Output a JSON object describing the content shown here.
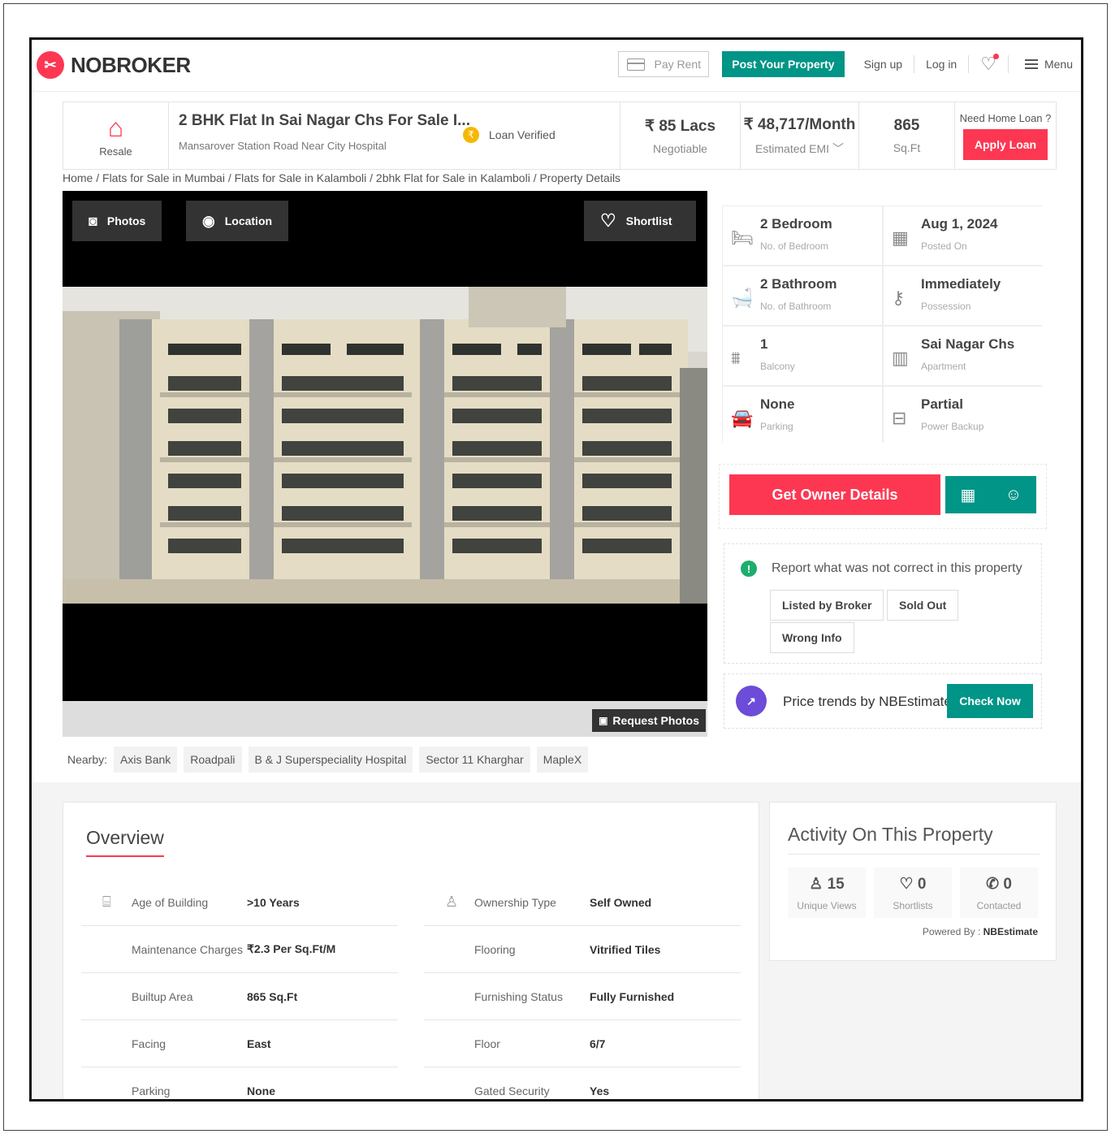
{
  "header": {
    "brand": "NOBROKER",
    "pay_rent": "Pay Rent",
    "post_property": "Post Your Property",
    "sign_up": "Sign up",
    "log_in": "Log in",
    "menu": "Menu"
  },
  "summary": {
    "type_label": "Resale",
    "title": "2 BHK Flat In Sai Nagar Chs For Sale I...",
    "address": "Mansarover Station Road Near City Hospital",
    "loan_badge": "Loan Verified",
    "price": "₹ 85 Lacs",
    "price_note": "Negotiable",
    "emi": "₹ 48,717/Month",
    "emi_note": "Estimated EMI",
    "area": "865",
    "area_unit": "Sq.Ft",
    "loan_question": "Need Home Loan ?",
    "apply_loan": "Apply Loan"
  },
  "breadcrumb": "Home / Flats for Sale in Mumbai / Flats for Sale in Kalamboli / 2bhk Flat for Sale in Kalamboli / Property Details",
  "gallery": {
    "photos": "Photos",
    "location": "Location",
    "shortlist": "Shortlist",
    "request_photos": "Request Photos"
  },
  "nearby": {
    "label": "Nearby:",
    "places": [
      "Axis Bank",
      "Roadpali",
      "B & J Superspeciality Hospital",
      "Sector 11 Kharghar",
      "MapleX"
    ]
  },
  "details": [
    {
      "icon": "bed-icon",
      "value": "2 Bedroom",
      "label": "No. of Bedroom"
    },
    {
      "icon": "calendar-icon",
      "value": "Aug 1, 2024",
      "label": "Posted On"
    },
    {
      "icon": "bathtub-icon",
      "value": "2 Bathroom",
      "label": "No. of Bathroom"
    },
    {
      "icon": "key-icon",
      "value": "Immediately",
      "label": "Possession"
    },
    {
      "icon": "balcony-icon",
      "value": "1",
      "label": "Balcony"
    },
    {
      "icon": "building-icon",
      "value": "Sai Nagar Chs",
      "label": "Apartment"
    },
    {
      "icon": "car-icon",
      "value": "None",
      "label": "Parking"
    },
    {
      "icon": "battery-icon",
      "value": "Partial",
      "label": "Power Backup"
    }
  ],
  "owner": {
    "button": "Get Owner Details"
  },
  "report": {
    "title": "Report what was not correct in this property",
    "options": [
      "Listed by Broker",
      "Sold Out",
      "Wrong Info"
    ]
  },
  "price_trends": {
    "text": "Price trends by NBEstimate",
    "button": "Check Now"
  },
  "overview": {
    "title": "Overview",
    "left": [
      {
        "label": "Age of Building",
        "value": ">10 Years"
      },
      {
        "label": "Maintenance Charges",
        "value": "₹2.3 Per Sq.Ft/M"
      },
      {
        "label": "Builtup Area",
        "value": "865 Sq.Ft"
      },
      {
        "label": "Facing",
        "value": "East"
      },
      {
        "label": "Parking",
        "value": "None"
      }
    ],
    "right": [
      {
        "label": "Ownership Type",
        "value": "Self Owned"
      },
      {
        "label": "Flooring",
        "value": "Vitrified Tiles"
      },
      {
        "label": "Furnishing Status",
        "value": "Fully Furnished"
      },
      {
        "label": "Floor",
        "value": "6/7"
      },
      {
        "label": "Gated Security",
        "value": "Yes"
      }
    ]
  },
  "activity": {
    "title": "Activity On This Property",
    "stats": [
      {
        "value": "15",
        "label": "Unique Views"
      },
      {
        "value": "0",
        "label": "Shortlists"
      },
      {
        "value": "0",
        "label": "Contacted"
      }
    ],
    "powered_label": "Powered By :",
    "powered_brand": "NBEstimate"
  },
  "colors": {
    "brand_red": "#fd3752",
    "brand_green": "#009587",
    "estimate_purple": "#6c4cd8"
  }
}
